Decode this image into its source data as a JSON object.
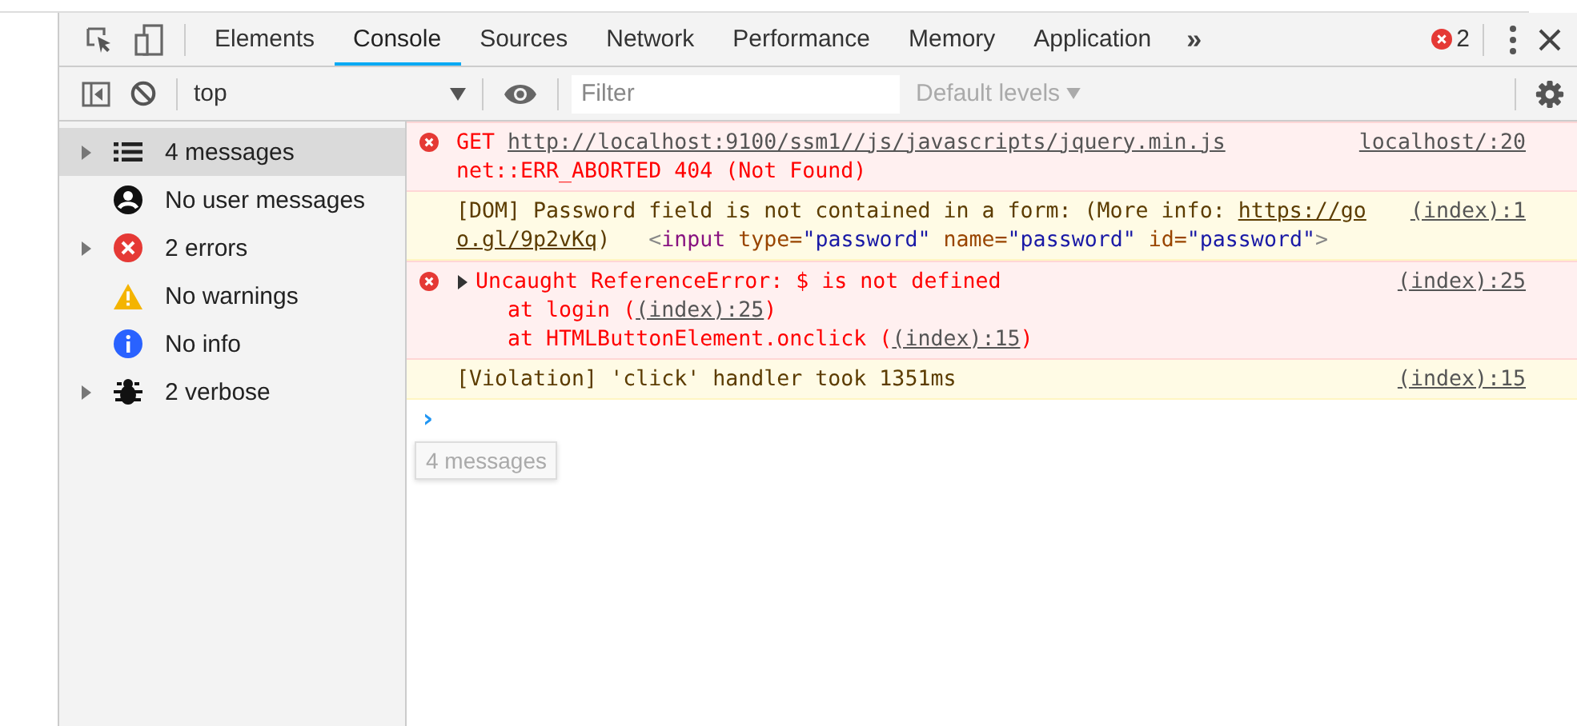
{
  "tabs": [
    {
      "label": "Elements",
      "selected": false
    },
    {
      "label": "Console",
      "selected": true
    },
    {
      "label": "Sources",
      "selected": false
    },
    {
      "label": "Network",
      "selected": false
    },
    {
      "label": "Performance",
      "selected": false
    },
    {
      "label": "Memory",
      "selected": false
    },
    {
      "label": "Application",
      "selected": false
    }
  ],
  "more_tabs": "»",
  "error_count": "2",
  "toolbar": {
    "context": "top",
    "filter_placeholder": "Filter",
    "levels": "Default levels"
  },
  "sidebar": {
    "items": [
      {
        "label": "4 messages",
        "kind": "list",
        "expandable": true,
        "selected": true
      },
      {
        "label": "No user messages",
        "kind": "user",
        "expandable": false,
        "selected": false
      },
      {
        "label": "2 errors",
        "kind": "error",
        "expandable": true,
        "selected": false
      },
      {
        "label": "No warnings",
        "kind": "warning",
        "expandable": false,
        "selected": false
      },
      {
        "label": "No info",
        "kind": "info",
        "expandable": false,
        "selected": false
      },
      {
        "label": "2 verbose",
        "kind": "verbose",
        "expandable": true,
        "selected": false
      }
    ]
  },
  "tooltip": "4 messages",
  "messages": [
    {
      "kind": "error",
      "source": "localhost/:20",
      "lines": [
        [
          {
            "t": "GET ",
            "kind": "plain"
          },
          {
            "t": "http://localhost:9100/ssm1//js/javascripts/jquery.min.js",
            "kind": "link"
          }
        ],
        [
          {
            "t": "net::ERR_ABORTED 404 (Not Found)",
            "kind": "plain"
          }
        ]
      ]
    },
    {
      "kind": "warning",
      "source": "(index):1",
      "lines": [
        [
          {
            "t": "[DOM] Password field is not contained in a form: (More info: ",
            "kind": "plain"
          },
          {
            "t": "https://go",
            "kind": "link"
          }
        ],
        [
          {
            "t": "o.gl/9p2vKq",
            "kind": "link"
          },
          {
            "t": ")   ",
            "kind": "plain"
          },
          {
            "t": "<",
            "kind": "punct"
          },
          {
            "t": "input",
            "kind": "tag"
          },
          {
            "t": " type",
            "kind": "attr"
          },
          {
            "t": "=",
            "kind": "attr"
          },
          {
            "t": "\"password\"",
            "kind": "value"
          },
          {
            "t": " name",
            "kind": "attr"
          },
          {
            "t": "=",
            "kind": "attr"
          },
          {
            "t": "\"password\"",
            "kind": "value"
          },
          {
            "t": " id",
            "kind": "attr"
          },
          {
            "t": "=",
            "kind": "attr"
          },
          {
            "t": "\"password\"",
            "kind": "value"
          },
          {
            "t": ">",
            "kind": "punct"
          }
        ]
      ]
    },
    {
      "kind": "error",
      "expanded": false,
      "source": "(index):25",
      "lines": [
        [
          {
            "t": "Uncaught ReferenceError: $ is not defined",
            "kind": "plain"
          }
        ],
        [
          {
            "t": "    at login (",
            "kind": "plain"
          },
          {
            "t": "(index):25",
            "kind": "link"
          },
          {
            "t": ")",
            "kind": "plain"
          }
        ],
        [
          {
            "t": "    at HTMLButtonElement.onclick (",
            "kind": "plain"
          },
          {
            "t": "(index):15",
            "kind": "link"
          },
          {
            "t": ")",
            "kind": "plain"
          }
        ]
      ]
    },
    {
      "kind": "violation",
      "source": "(index):15",
      "lines": [
        [
          {
            "t": "[Violation] 'click' handler took 1351ms",
            "kind": "plain"
          }
        ]
      ]
    }
  ],
  "prompt": "›"
}
